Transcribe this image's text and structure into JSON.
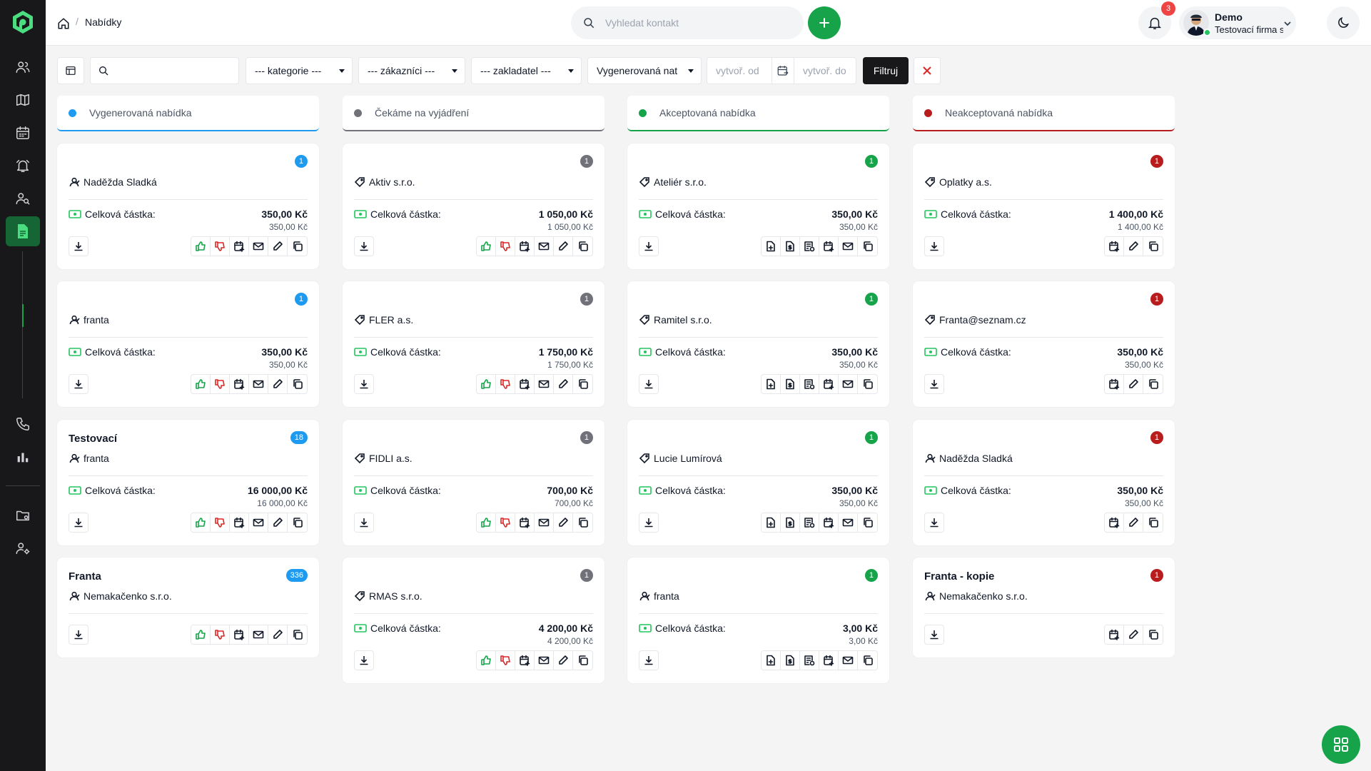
{
  "breadcrumb": {
    "current": "Nabídky"
  },
  "search": {
    "placeholder": "Vyhledat kontakt"
  },
  "notifications": {
    "count": "3"
  },
  "user": {
    "name": "Demo",
    "company": "Testovací firma s.r..."
  },
  "filters": {
    "search_value": "",
    "category": "--- kategorie ---",
    "customers": "--- zákazníci ---",
    "founder": "--- zakladatel ---",
    "status": "Vygenerovaná nat",
    "created_from_placeholder": "vytvoř. od",
    "created_to_placeholder": "vytvoř. do",
    "filter_label": "Filtruj"
  },
  "amount_label": "Celková částka:",
  "columns": [
    {
      "title": "Vygenerovaná nabídka",
      "color": "#1e9bf0",
      "cards": [
        {
          "title": "",
          "contact": "Naděžda Sladká",
          "contact_icon": "person-icon",
          "badge": "1",
          "amount": "350,00 Kč",
          "amount_sub": "350,00 Kč"
        },
        {
          "title": "",
          "contact": "franta",
          "contact_icon": "person-icon",
          "badge": "1",
          "amount": "350,00 Kč",
          "amount_sub": "350,00 Kč"
        },
        {
          "title": "Testovací",
          "contact": "franta",
          "contact_icon": "person-icon",
          "badge": "18",
          "amount": "16 000,00 Kč",
          "amount_sub": "16 000,00 Kč"
        },
        {
          "title": "Franta",
          "contact": "Nemakačenko s.r.o.",
          "contact_icon": "person-icon",
          "badge": "336",
          "amount": "",
          "amount_sub": ""
        }
      ]
    },
    {
      "title": "Čekáme na vyjádření",
      "color": "#71717a",
      "cards": [
        {
          "title": "",
          "contact": "Aktiv s.r.o.",
          "contact_icon": "tag-icon",
          "badge": "1",
          "amount": "1 050,00 Kč",
          "amount_sub": "1 050,00 Kč"
        },
        {
          "title": "",
          "contact": "FLER a.s.",
          "contact_icon": "tag-icon",
          "badge": "1",
          "amount": "1 750,00 Kč",
          "amount_sub": "1 750,00 Kč"
        },
        {
          "title": "",
          "contact": "FIDLI a.s.",
          "contact_icon": "tag-icon",
          "badge": "1",
          "amount": "700,00 Kč",
          "amount_sub": "700,00 Kč"
        },
        {
          "title": "",
          "contact": "RMAS s.r.o.",
          "contact_icon": "tag-icon",
          "badge": "1",
          "amount": "4 200,00 Kč",
          "amount_sub": "4 200,00 Kč"
        }
      ]
    },
    {
      "title": "Akceptovaná nabídka",
      "color": "#16a34a",
      "cards": [
        {
          "title": "",
          "contact": "Ateliér s.r.o.",
          "contact_icon": "tag-icon",
          "badge": "1",
          "amount": "350,00 Kč",
          "amount_sub": "350,00 Kč"
        },
        {
          "title": "",
          "contact": "Ramitel s.r.o.",
          "contact_icon": "tag-icon",
          "badge": "1",
          "amount": "350,00 Kč",
          "amount_sub": "350,00 Kč"
        },
        {
          "title": "",
          "contact": "Lucie Lumírová",
          "contact_icon": "tag-icon",
          "badge": "1",
          "amount": "350,00 Kč",
          "amount_sub": "350,00 Kč"
        },
        {
          "title": "",
          "contact": "franta",
          "contact_icon": "person-icon",
          "badge": "1",
          "amount": "3,00 Kč",
          "amount_sub": "3,00 Kč"
        }
      ]
    },
    {
      "title": "Neakceptovaná nabídka",
      "color": "#b91c1c",
      "cards": [
        {
          "title": "",
          "contact": "Oplatky a.s.",
          "contact_icon": "tag-icon",
          "badge": "1",
          "amount": "1 400,00 Kč",
          "amount_sub": "1 400,00 Kč"
        },
        {
          "title": "",
          "contact": "Franta@seznam.cz",
          "contact_icon": "tag-icon",
          "badge": "1",
          "amount": "350,00 Kč",
          "amount_sub": "350,00 Kč"
        },
        {
          "title": "",
          "contact": "Naděžda Sladká",
          "contact_icon": "person-icon",
          "badge": "1",
          "amount": "350,00 Kč",
          "amount_sub": "350,00 Kč"
        },
        {
          "title": "Franta - kopie",
          "contact": "Nemakačenko s.r.o.",
          "contact_icon": "person-icon",
          "badge": "1",
          "amount": "",
          "amount_sub": ""
        }
      ]
    }
  ],
  "card_actions": {
    "pending": [
      "thumbs-up-icon",
      "thumbs-down-icon",
      "calendar-add-icon",
      "mail-icon",
      "pencil-icon",
      "copy-icon"
    ],
    "accepted": [
      "document-add-icon",
      "invoice-icon",
      "list-document-icon",
      "calendar-add-icon",
      "mail-icon",
      "copy-icon"
    ],
    "rejected": [
      "calendar-add-icon",
      "pencil-icon",
      "copy-icon"
    ]
  }
}
